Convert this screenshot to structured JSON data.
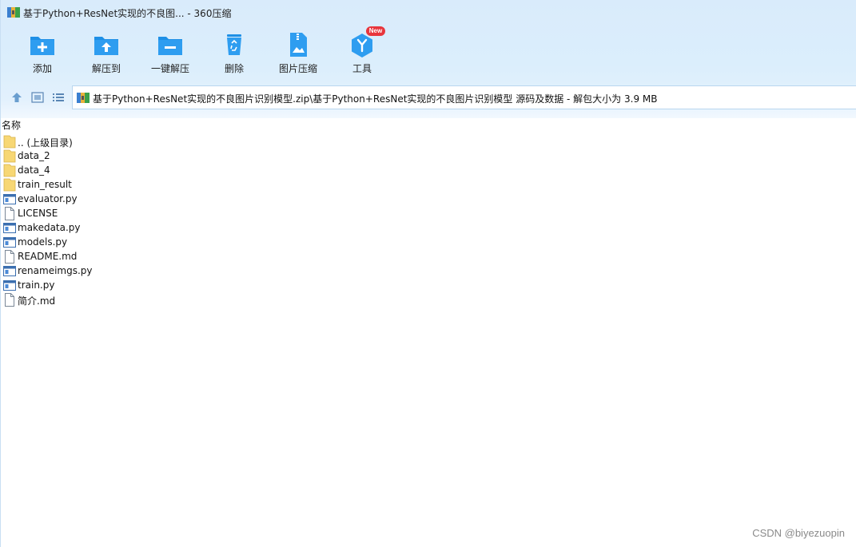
{
  "window": {
    "title": "基于Python+ResNet实现的不良图... - 360压缩"
  },
  "toolbar": {
    "items": [
      {
        "label": "添加",
        "icon": "add-folder-icon"
      },
      {
        "label": "解压到",
        "icon": "extract-to-icon"
      },
      {
        "label": "一键解压",
        "icon": "one-click-extract-icon"
      },
      {
        "label": "删除",
        "icon": "trash-icon"
      },
      {
        "label": "图片压缩",
        "icon": "image-compress-icon"
      },
      {
        "label": "工具",
        "icon": "tools-icon"
      }
    ],
    "new_badge": "New"
  },
  "nav": {
    "up_icon": "arrow-up-icon",
    "thumbnail_icon": "thumbnail-view-icon",
    "list_icon": "list-view-icon"
  },
  "address": {
    "path": "基于Python+ResNet实现的不良图片识别模型.zip\\基于Python+ResNet实现的不良图片识别模型 源码及数据 - 解包大小为 3.9 MB"
  },
  "list": {
    "column_name": "名称",
    "files": [
      {
        "name": ".. (上级目录)",
        "type": "folder"
      },
      {
        "name": "data_2",
        "type": "folder"
      },
      {
        "name": "data_4",
        "type": "folder"
      },
      {
        "name": "train_result",
        "type": "folder"
      },
      {
        "name": "evaluator.py",
        "type": "py"
      },
      {
        "name": "LICENSE",
        "type": "file"
      },
      {
        "name": "makedata.py",
        "type": "py"
      },
      {
        "name": "models.py",
        "type": "py"
      },
      {
        "name": "README.md",
        "type": "file"
      },
      {
        "name": "renameimgs.py",
        "type": "py"
      },
      {
        "name": "train.py",
        "type": "py"
      },
      {
        "name": "简介.md",
        "type": "file"
      }
    ]
  },
  "watermark": "CSDN @biyezuopin",
  "colors": {
    "accent_blue": "#1e8fe6",
    "badge_red": "#e8353c",
    "folder_yellow": "#f7d774"
  }
}
